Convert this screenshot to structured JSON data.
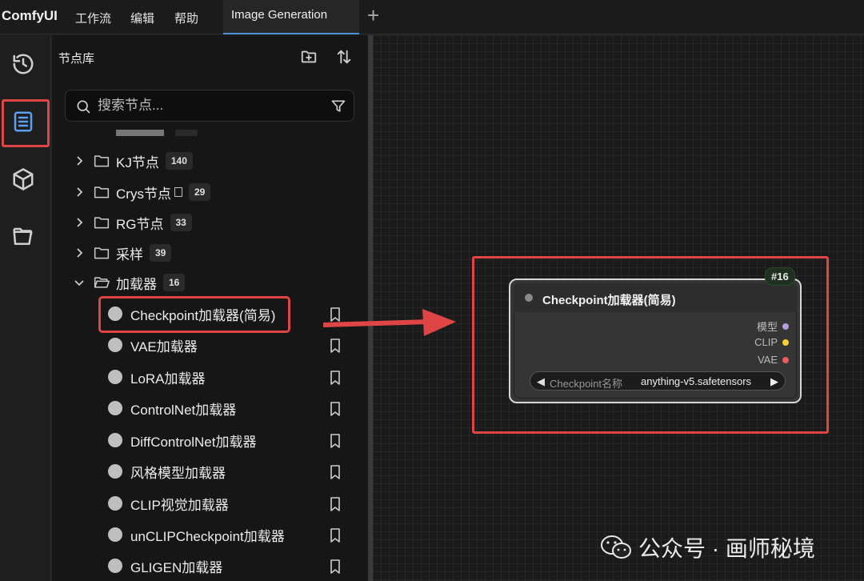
{
  "app": {
    "logo": "ComfyUI"
  },
  "menu": [
    "工作流",
    "编辑",
    "帮助"
  ],
  "tab": {
    "label": "Image Generation",
    "add_label": "+"
  },
  "sidebar": {
    "title": "节点库",
    "search_placeholder": "搜索节点...",
    "categories": [
      {
        "label": "KJ节点",
        "count": "140",
        "expanded": false
      },
      {
        "label": "Crys节点",
        "count": "29",
        "expanded": false
      },
      {
        "label": "RG节点",
        "count": "33",
        "expanded": false
      },
      {
        "label": "采样",
        "count": "39",
        "expanded": false
      },
      {
        "label": "加载器",
        "count": "16",
        "expanded": true
      }
    ],
    "nodes": [
      "Checkpoint加载器(简易)",
      "VAE加载器",
      "LoRA加载器",
      "ControlNet加载器",
      "DiffControlNet加载器",
      "风格模型加载器",
      "CLIP视觉加载器",
      "unCLIPCheckpoint加载器",
      "GLIGEN加载器"
    ]
  },
  "canvas_node": {
    "id": "#16",
    "title": "Checkpoint加载器(简易)",
    "outputs": [
      {
        "label": "模型",
        "color": "#b39ddb"
      },
      {
        "label": "CLIP",
        "color": "#f5d130"
      },
      {
        "label": "VAE",
        "color": "#ef5b5b"
      }
    ],
    "widget": {
      "left_arrow": "◀",
      "label": "Checkpoint名称",
      "value": "anything-v5.safetensors",
      "right_arrow": "▶"
    }
  },
  "watermark": {
    "text": "公众号 · 画师秘境"
  },
  "colors": {
    "highlight": "#e04545",
    "accent": "#4a8fd8",
    "rail_active": "#5aa0f0"
  }
}
